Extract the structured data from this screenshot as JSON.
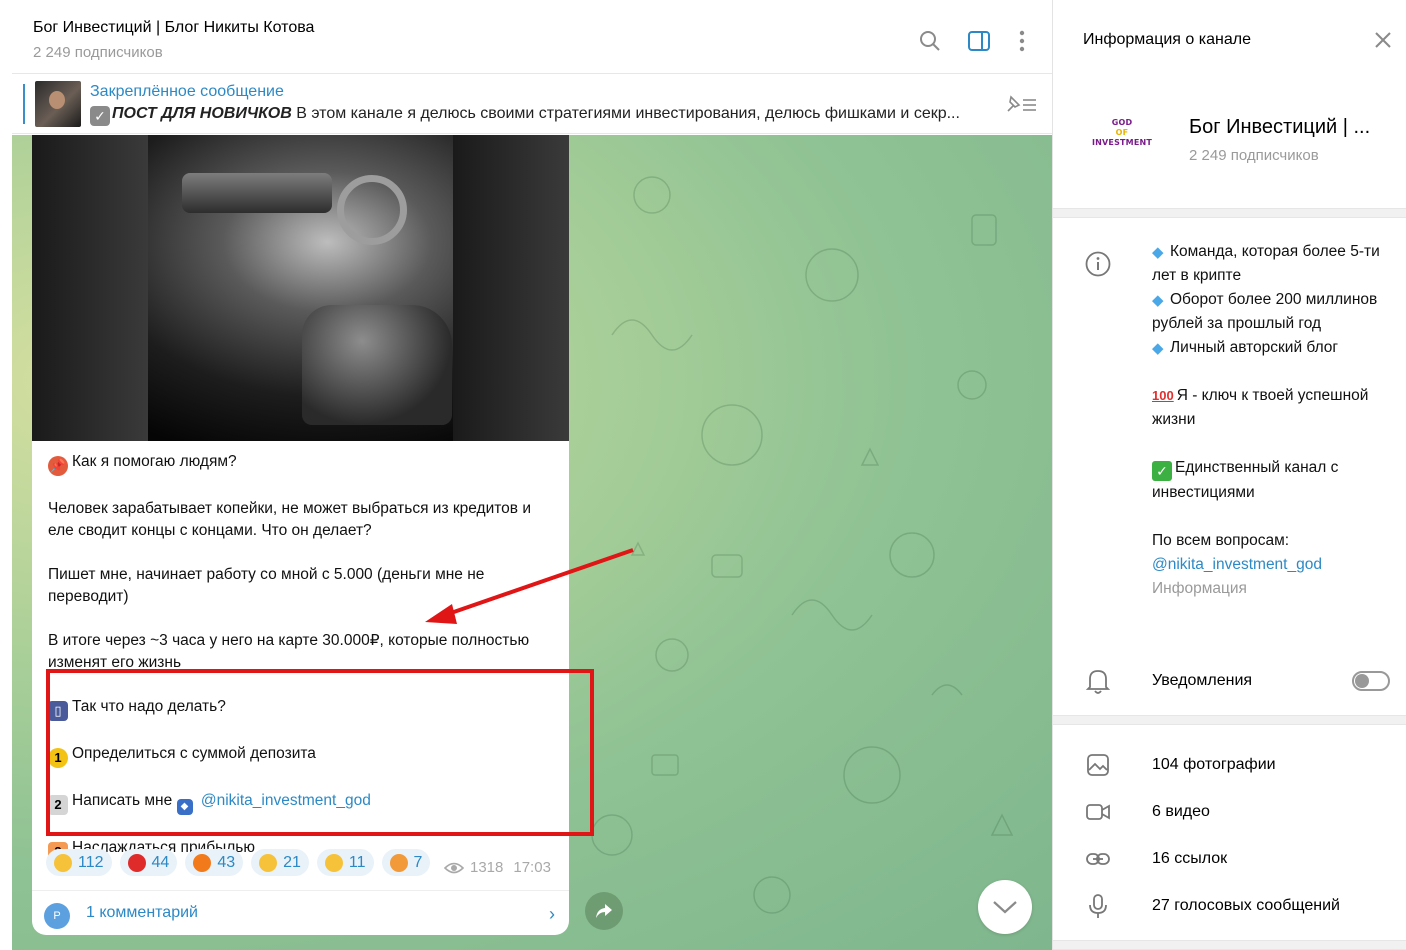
{
  "header": {
    "title": "Бог Инвестиций | Блог Никиты Котова",
    "subscribers": "2 249 подписчиков",
    "icons": [
      "search-icon",
      "sidebar-toggle-icon",
      "more-vertical-icon"
    ]
  },
  "pinned": {
    "label": "Закреплённое сообщение",
    "bold_text": "ПОСТ ДЛЯ НОВИЧКОВ",
    "text": " В этом канале я делюсь своими стратегиями инвестирования, делюсь фишками и секр..."
  },
  "message": {
    "heading": "Как я помогаю людям?",
    "p1": "Человек зарабатывает копейки, не может выбраться из кредитов и еле сводит концы с концами. Что он делает?",
    "p2": "Пишет мне, начинает работу со мной с 5.000 (деньги мне не переводит)",
    "p3": "В итоге через ~3 часа у него на карте 30.000₽, которые полностью изменят его жизнь",
    "q": "Так что надо делать?",
    "step1": "Определиться с суммой депозита",
    "step2": "Написать мне",
    "step2_link": "@nikita_investment_god",
    "step3": "Наслаждаться прибылью",
    "reactions": [
      {
        "emoji": "laugh",
        "count": "112",
        "color": "#f6c23a"
      },
      {
        "emoji": "heart",
        "count": "44",
        "color": "#e02b2b"
      },
      {
        "emoji": "fire",
        "count": "43",
        "color": "#f27a1a"
      },
      {
        "emoji": "clap",
        "count": "21",
        "color": "#f6c23a"
      },
      {
        "emoji": "thumbs-up",
        "count": "11",
        "color": "#f6c23a"
      },
      {
        "emoji": "love-face",
        "count": "7",
        "color": "#f29a3a"
      }
    ],
    "views": "1318",
    "time": "17:03",
    "comment_avatar": "P",
    "comments": "1 комментарий"
  },
  "panel": {
    "title": "Информация о канале",
    "channel_name": "Бог Инвестиций | ...",
    "subscribers": "2 249 подписчиков",
    "avatar_lines": [
      "GOD",
      "OF",
      "INVESTMENT"
    ],
    "desc1": "Команда, которая более 5-ти лет в крипте",
    "desc2": "Оборот более 200 миллинов рублей за прошлый год",
    "desc3": "Личный авторский блог",
    "desc4": "Я - ключ к твоей успешной жизни",
    "desc5": "Единственный канал с инвестициями",
    "desc6": "По всем вопросам:",
    "desc_link": "@nikita_investment_god",
    "desc_sub": "Информация",
    "notifications": "Уведомления",
    "media": {
      "photos": "104 фотографии",
      "videos": "6 видео",
      "links": "16 ссылок",
      "voice": "27 голосовых сообщений"
    }
  },
  "colors": {
    "accent": "#2c89c5",
    "annotation": "#e01515",
    "muted": "#9a9a9a"
  }
}
